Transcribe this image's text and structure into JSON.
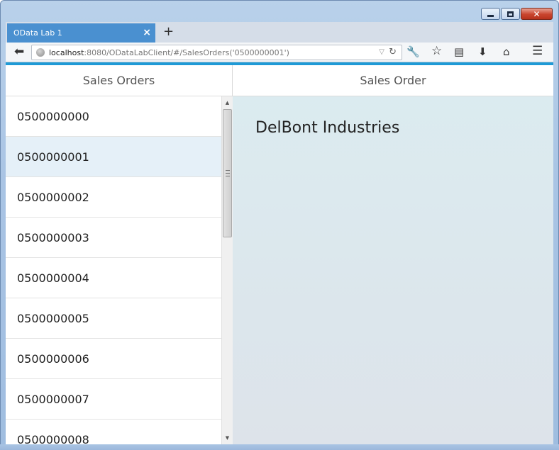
{
  "browser": {
    "tab_title": "OData Lab 1",
    "tab_close": "×",
    "new_tab": "+",
    "url_host": "localhost",
    "url_rest": ":8080/ODataLabClient/#/SalesOrders('0500000001')",
    "caption_close": "✕"
  },
  "master": {
    "title": "Sales Orders",
    "items": [
      {
        "label": "0500000000"
      },
      {
        "label": "0500000001",
        "selected": true
      },
      {
        "label": "0500000002"
      },
      {
        "label": "0500000003"
      },
      {
        "label": "0500000004"
      },
      {
        "label": "0500000005"
      },
      {
        "label": "0500000006"
      },
      {
        "label": "0500000007"
      },
      {
        "label": "0500000008"
      }
    ]
  },
  "detail": {
    "title": "Sales Order",
    "customer_name": "DelBont Industries"
  },
  "colors": {
    "accent": "#1f9ad6",
    "tab_active": "#4a90d0",
    "selected_row": "#e5f0f8"
  },
  "icons": [
    "back-icon",
    "globe-icon",
    "reload-icon",
    "wrench-icon",
    "star-icon",
    "clipboard-icon",
    "download-icon",
    "home-icon",
    "menu-icon"
  ]
}
